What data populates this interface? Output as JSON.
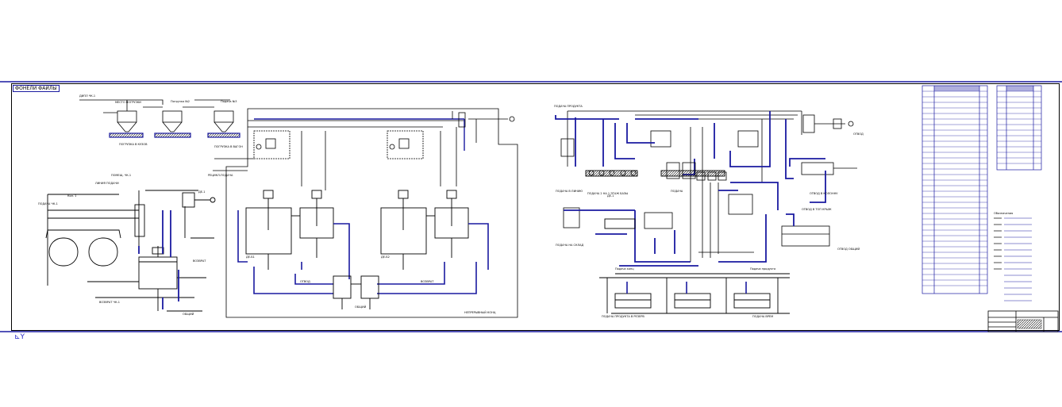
{
  "drawing": {
    "tab_label": "ФОНЕЛИ ФАЙЛЫ",
    "status_glyph": "⊾Y",
    "colors": {
      "ink": "#000000",
      "process_blue": "#1a1aa0",
      "background": "#ffffff"
    }
  }
}
